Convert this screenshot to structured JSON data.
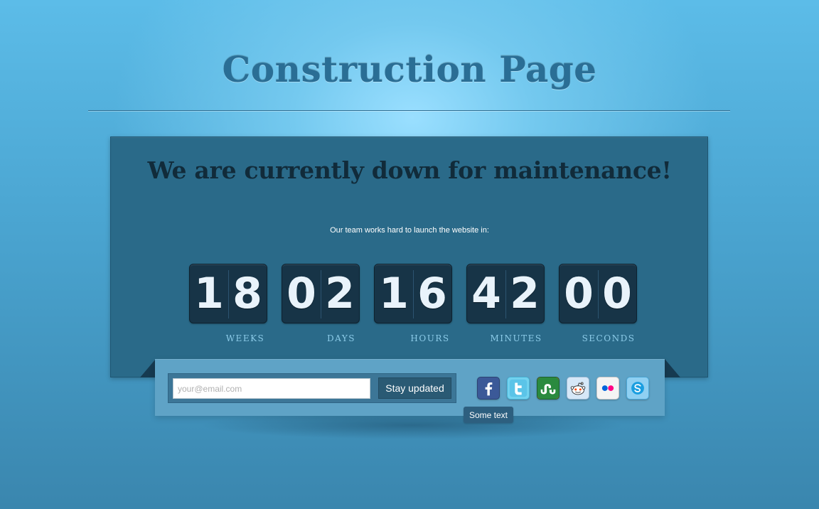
{
  "page": {
    "title": "Construction Page"
  },
  "panel": {
    "headline": "We are currently down for maintenance!",
    "subtext": "Our team works hard to launch the website in:"
  },
  "countdown": [
    {
      "digits": [
        "1",
        "8"
      ],
      "label": "WEEKS"
    },
    {
      "digits": [
        "0",
        "2"
      ],
      "label": "DAYS"
    },
    {
      "digits": [
        "1",
        "6"
      ],
      "label": "HOURS"
    },
    {
      "digits": [
        "4",
        "2"
      ],
      "label": "MINUTES"
    },
    {
      "digits": [
        "0",
        "0"
      ],
      "label": "SECONDS"
    }
  ],
  "subscribe": {
    "email_placeholder": "your@email.com",
    "email_value": "",
    "button_label": "Stay updated"
  },
  "social": [
    {
      "icon": "facebook-icon"
    },
    {
      "icon": "twitter-icon"
    },
    {
      "icon": "stumbleupon-icon"
    },
    {
      "icon": "reddit-icon"
    },
    {
      "icon": "flickr-icon"
    },
    {
      "icon": "skype-icon"
    }
  ],
  "tooltip": {
    "text": "Some text"
  },
  "colors": {
    "background_light": "#9adfff",
    "background_dark": "#3a86ae",
    "panel": "#2a6a89",
    "counter": "#173447",
    "band": "#5fa3c6",
    "button": "#2a5a74"
  }
}
